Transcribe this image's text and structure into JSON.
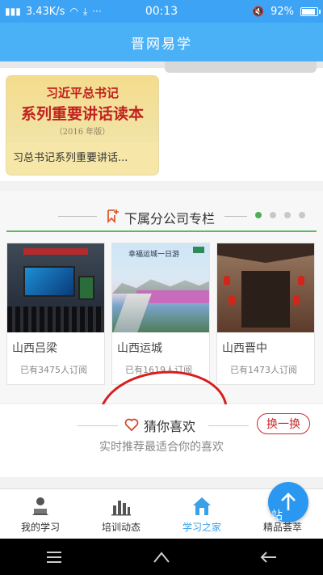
{
  "status_bar": {
    "network_speed": "3.43K/s",
    "time": "00:13",
    "battery_percent": "92%",
    "battery_level": 0.92
  },
  "header": {
    "title": "晋网易学"
  },
  "featured_book": {
    "cover_line1": "习近平总书记",
    "cover_line2": "系列重要讲话读本",
    "cover_line3": "（2016 年版）",
    "title": "习总书记系列重要讲话..."
  },
  "subsidiary": {
    "title": "下属分公司专栏",
    "page_count": 4,
    "active_page": 0,
    "cards": [
      {
        "name": "山西吕梁",
        "count": "已有3475人订阅"
      },
      {
        "name": "山西运城",
        "count": "已有1619人订阅"
      },
      {
        "name": "山西晋中",
        "count": "已有1473人订阅"
      }
    ],
    "yuncheng_caption": "幸福运城一日游"
  },
  "recommend": {
    "title": "猜你喜欢",
    "subtitle": "实时推荐最适合你的喜欢",
    "refresh_label": "换一换"
  },
  "bottom_nav": {
    "items": [
      {
        "label": "我的学习",
        "icon": "reader-icon"
      },
      {
        "label": "培训动态",
        "icon": "bar-chart-icon"
      },
      {
        "label": "学习之家",
        "icon": "home-icon"
      },
      {
        "label": "精品荟萃",
        "icon": "gallery-icon"
      }
    ],
    "active_index": 2
  },
  "fab": {
    "badge": "站"
  },
  "colors": {
    "status_bar": "#3da3f5",
    "header": "#4ab1f7",
    "active_tab": "#3aa0e8",
    "accent_red": "#c82a2a",
    "indicator_green": "#4caf50"
  }
}
